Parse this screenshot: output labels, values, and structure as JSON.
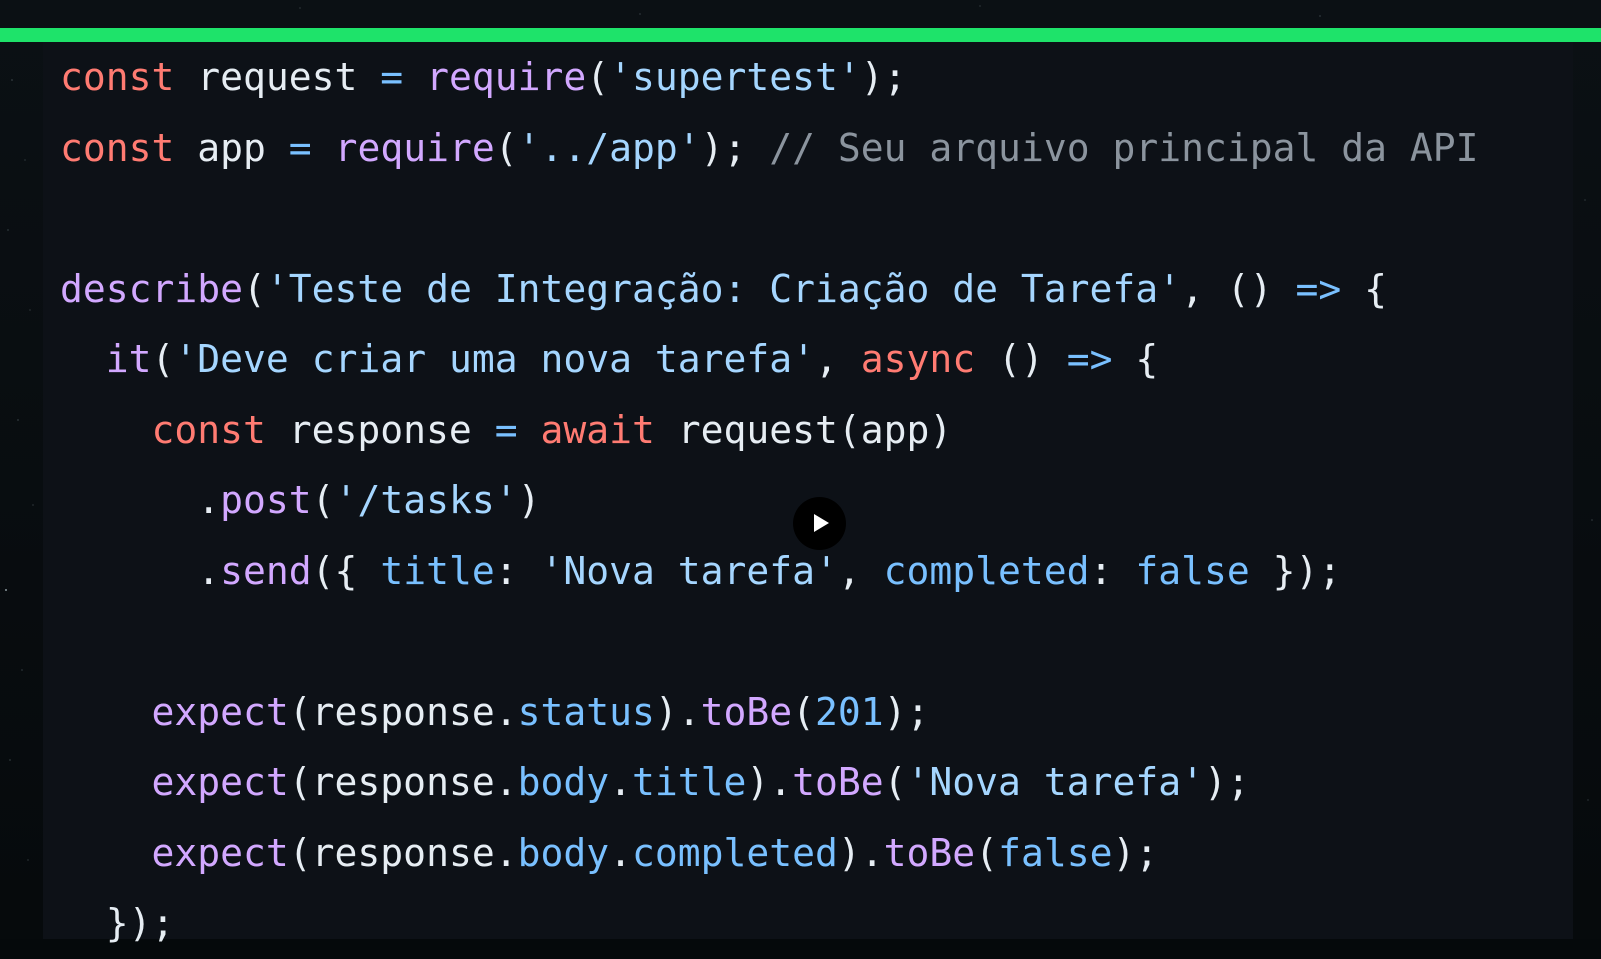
{
  "colors": {
    "accent_bar": "#1ee36a",
    "editor_background": "#0d1117",
    "keyword": "#ff7b72",
    "function": "#d2a8ff",
    "string": "#a5d6ff",
    "property": "#79c0ff",
    "comment": "#8b949e",
    "plain": "#e6edf3"
  },
  "player": {
    "play_icon": "play-icon"
  },
  "code": {
    "lines": [
      [
        {
          "t": "const",
          "k": "kw"
        },
        {
          "t": " request ",
          "k": "pl"
        },
        {
          "t": "=",
          "k": "op"
        },
        {
          "t": " ",
          "k": "pl"
        },
        {
          "t": "require",
          "k": "fn"
        },
        {
          "t": "(",
          "k": "pl"
        },
        {
          "t": "'supertest'",
          "k": "str"
        },
        {
          "t": ");",
          "k": "pl"
        }
      ],
      [
        {
          "t": "const",
          "k": "kw"
        },
        {
          "t": " app ",
          "k": "pl"
        },
        {
          "t": "=",
          "k": "op"
        },
        {
          "t": " ",
          "k": "pl"
        },
        {
          "t": "require",
          "k": "fn"
        },
        {
          "t": "(",
          "k": "pl"
        },
        {
          "t": "'../app'",
          "k": "str"
        },
        {
          "t": "); ",
          "k": "pl"
        },
        {
          "t": "// Seu arquivo principal da API",
          "k": "cm"
        }
      ],
      [],
      [
        {
          "t": "describe",
          "k": "fn"
        },
        {
          "t": "(",
          "k": "pl"
        },
        {
          "t": "'Teste de Integração: Criação de Tarefa'",
          "k": "str"
        },
        {
          "t": ", () ",
          "k": "pl"
        },
        {
          "t": "=>",
          "k": "op"
        },
        {
          "t": " {",
          "k": "pl"
        }
      ],
      [
        {
          "t": "  ",
          "k": "pl"
        },
        {
          "t": "it",
          "k": "fn"
        },
        {
          "t": "(",
          "k": "pl"
        },
        {
          "t": "'Deve criar uma nova tarefa'",
          "k": "str"
        },
        {
          "t": ", ",
          "k": "pl"
        },
        {
          "t": "async",
          "k": "kw"
        },
        {
          "t": " () ",
          "k": "pl"
        },
        {
          "t": "=>",
          "k": "op"
        },
        {
          "t": " {",
          "k": "pl"
        }
      ],
      [
        {
          "t": "    ",
          "k": "pl"
        },
        {
          "t": "const",
          "k": "kw"
        },
        {
          "t": " response ",
          "k": "pl"
        },
        {
          "t": "=",
          "k": "op"
        },
        {
          "t": " ",
          "k": "pl"
        },
        {
          "t": "await",
          "k": "kw"
        },
        {
          "t": " request(app)",
          "k": "pl"
        }
      ],
      [
        {
          "t": "      .",
          "k": "pl"
        },
        {
          "t": "post",
          "k": "fn"
        },
        {
          "t": "(",
          "k": "pl"
        },
        {
          "t": "'/tasks'",
          "k": "str"
        },
        {
          "t": ")",
          "k": "pl"
        }
      ],
      [
        {
          "t": "      .",
          "k": "pl"
        },
        {
          "t": "send",
          "k": "fn"
        },
        {
          "t": "({ ",
          "k": "pl"
        },
        {
          "t": "title",
          "k": "prop"
        },
        {
          "t": ": ",
          "k": "pl"
        },
        {
          "t": "'Nova tarefa'",
          "k": "str"
        },
        {
          "t": ", ",
          "k": "pl"
        },
        {
          "t": "completed",
          "k": "prop"
        },
        {
          "t": ": ",
          "k": "pl"
        },
        {
          "t": "false",
          "k": "num"
        },
        {
          "t": " });",
          "k": "pl"
        }
      ],
      [],
      [
        {
          "t": "    ",
          "k": "pl"
        },
        {
          "t": "expect",
          "k": "fn"
        },
        {
          "t": "(response.",
          "k": "pl"
        },
        {
          "t": "status",
          "k": "prop"
        },
        {
          "t": ").",
          "k": "pl"
        },
        {
          "t": "toBe",
          "k": "fn"
        },
        {
          "t": "(",
          "k": "pl"
        },
        {
          "t": "201",
          "k": "num"
        },
        {
          "t": ");",
          "k": "pl"
        }
      ],
      [
        {
          "t": "    ",
          "k": "pl"
        },
        {
          "t": "expect",
          "k": "fn"
        },
        {
          "t": "(response.",
          "k": "pl"
        },
        {
          "t": "body",
          "k": "prop"
        },
        {
          "t": ".",
          "k": "pl"
        },
        {
          "t": "title",
          "k": "prop"
        },
        {
          "t": ").",
          "k": "pl"
        },
        {
          "t": "toBe",
          "k": "fn"
        },
        {
          "t": "(",
          "k": "pl"
        },
        {
          "t": "'Nova tarefa'",
          "k": "str"
        },
        {
          "t": ");",
          "k": "pl"
        }
      ],
      [
        {
          "t": "    ",
          "k": "pl"
        },
        {
          "t": "expect",
          "k": "fn"
        },
        {
          "t": "(response.",
          "k": "pl"
        },
        {
          "t": "body",
          "k": "prop"
        },
        {
          "t": ".",
          "k": "pl"
        },
        {
          "t": "completed",
          "k": "prop"
        },
        {
          "t": ").",
          "k": "pl"
        },
        {
          "t": "toBe",
          "k": "fn"
        },
        {
          "t": "(",
          "k": "pl"
        },
        {
          "t": "false",
          "k": "num"
        },
        {
          "t": ");",
          "k": "pl"
        }
      ],
      [
        {
          "t": "  });",
          "k": "pl"
        }
      ]
    ]
  }
}
